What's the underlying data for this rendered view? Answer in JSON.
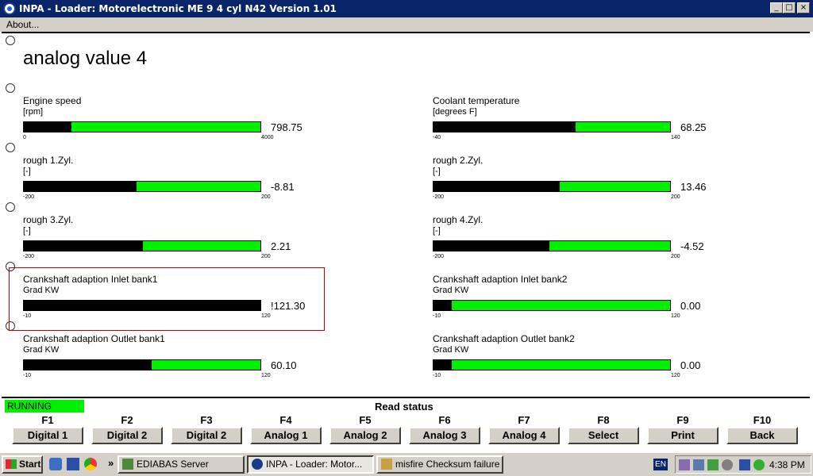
{
  "window": {
    "title": "INPA - Loader: Motorelectronic ME 9  4 cyl N42 Version 1.01",
    "minimize": "_",
    "maximize": "□",
    "close": "×"
  },
  "menu": {
    "about": "About..."
  },
  "page_title": "analog value 4",
  "gauges": {
    "engine_speed": {
      "label": "Engine speed",
      "unit": "[rpm]",
      "value": "798.75",
      "min": "0",
      "max": "4000",
      "fill_fraction": 0.2
    },
    "coolant_temp": {
      "label": "Coolant temperature",
      "unit": "[degrees F]",
      "value": "68.25",
      "min": "-40",
      "max": "140",
      "fill_fraction": 0.6
    },
    "rough1": {
      "label": "rough 1.Zyl.",
      "unit": "[-]",
      "value": "-8.81",
      "min": "-200",
      "max": "200",
      "fill_fraction": 0.478
    },
    "rough2": {
      "label": "rough 2.Zyl.",
      "unit": "[-]",
      "value": "13.46",
      "min": "-200",
      "max": "200",
      "fill_fraction": 0.534
    },
    "rough3": {
      "label": "rough 3.Zyl.",
      "unit": "[-]",
      "value": "2.21",
      "min": "-200",
      "max": "200",
      "fill_fraction": 0.505
    },
    "rough4": {
      "label": "rough 4.Zyl.",
      "unit": "[-]",
      "value": "-4.52",
      "min": "-200",
      "max": "200",
      "fill_fraction": 0.489
    },
    "crank_inlet1": {
      "label": "Crankshaft adaption Inlet bank1",
      "unit": "Grad KW",
      "value": "!121.30",
      "min": "-10",
      "max": "120",
      "fill_fraction": 1.0
    },
    "crank_inlet2": {
      "label": "Crankshaft adaption Inlet bank2",
      "unit": "Grad KW",
      "value": "0.00",
      "min": "-10",
      "max": "120",
      "fill_fraction": 0.077
    },
    "crank_outlet1": {
      "label": "Crankshaft adaption Outlet bank1",
      "unit": "Grad KW",
      "value": "60.10",
      "min": "-10",
      "max": "120",
      "fill_fraction": 0.539
    },
    "crank_outlet2": {
      "label": "Crankshaft adaption Outlet bank2",
      "unit": "Grad KW",
      "value": "0.00",
      "min": "-10",
      "max": "120",
      "fill_fraction": 0.077
    }
  },
  "status": {
    "running": "RUNNING",
    "read_status": "Read status"
  },
  "fkeys": [
    {
      "key": "F1",
      "label": "Digital 1"
    },
    {
      "key": "F2",
      "label": "Digital 2"
    },
    {
      "key": "F3",
      "label": "Digital 2"
    },
    {
      "key": "F4",
      "label": "Analog 1"
    },
    {
      "key": "F5",
      "label": "Analog 2"
    },
    {
      "key": "F6",
      "label": "Analog 3"
    },
    {
      "key": "F7",
      "label": "Analog 4"
    },
    {
      "key": "F8",
      "label": "Select"
    },
    {
      "key": "F9",
      "label": "Print"
    },
    {
      "key": "F10",
      "label": "Back"
    }
  ],
  "taskbar": {
    "start": "Start",
    "quicklaunch_more": "»",
    "tasks": [
      {
        "label": "EDIABAS Server"
      },
      {
        "label": "INPA - Loader: Motor..."
      },
      {
        "label": "misfire Checksum failure ..."
      }
    ],
    "lang": "EN",
    "clock": "4:38 PM"
  },
  "colors": {
    "bar_green": "#00f000",
    "bar_fill": "#000000",
    "titlebar": "#0a246a",
    "highlight_border": "#c00000"
  }
}
